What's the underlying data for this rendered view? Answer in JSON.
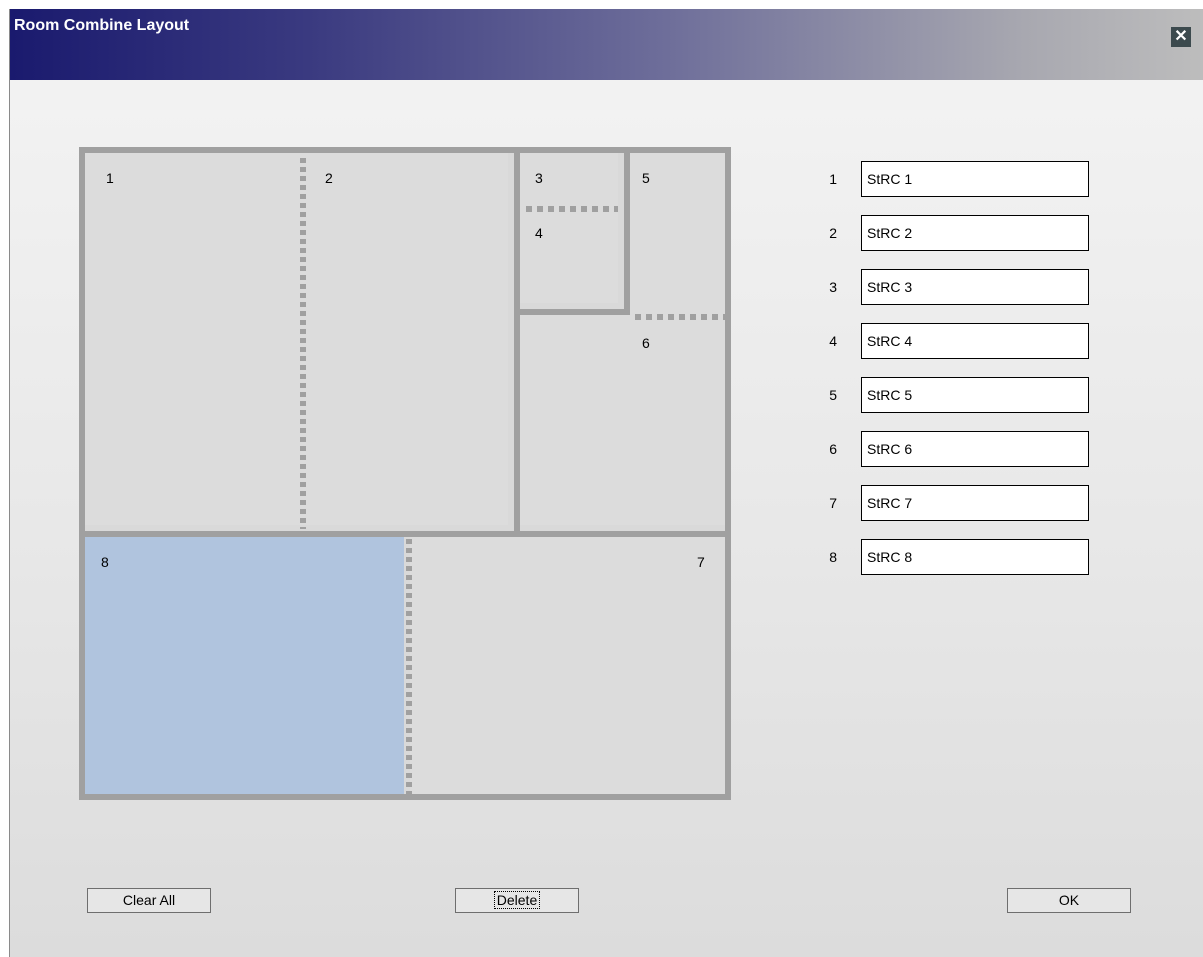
{
  "window": {
    "title": "Room Combine Layout",
    "close_icon": "close-icon",
    "close_glyph": "✕"
  },
  "floorplan": {
    "selected_room": "8",
    "selected_color": "#b0c4de",
    "rooms": [
      {
        "number": "1"
      },
      {
        "number": "2"
      },
      {
        "number": "3"
      },
      {
        "number": "4"
      },
      {
        "number": "5"
      },
      {
        "number": "6"
      },
      {
        "number": "7"
      },
      {
        "number": "8"
      }
    ]
  },
  "room_names": [
    {
      "number": "1",
      "value": "StRC 1"
    },
    {
      "number": "2",
      "value": "StRC 2"
    },
    {
      "number": "3",
      "value": "StRC 3"
    },
    {
      "number": "4",
      "value": "StRC 4"
    },
    {
      "number": "5",
      "value": "StRC 5"
    },
    {
      "number": "6",
      "value": "StRC 6"
    },
    {
      "number": "7",
      "value": "StRC 7"
    },
    {
      "number": "8",
      "value": "StRC 8"
    }
  ],
  "buttons": {
    "clear_all": "Clear All",
    "delete": "Delete",
    "ok": "OK"
  }
}
